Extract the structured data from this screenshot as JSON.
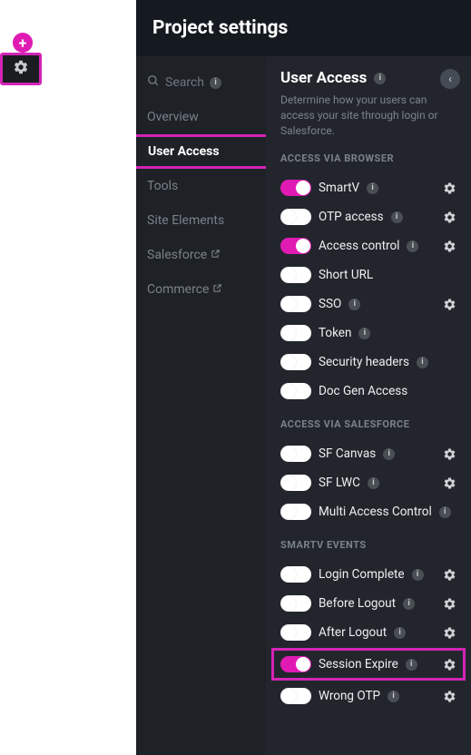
{
  "colors": {
    "accent": "#e01bb4",
    "highlight": "#d324b7"
  },
  "plus_label": "+",
  "gear_btn": "gear",
  "panel": {
    "title": "Project settings",
    "search_placeholder": "Search",
    "nav": [
      {
        "label": "Overview",
        "active": false,
        "external": false
      },
      {
        "label": "User Access",
        "active": true,
        "external": false
      },
      {
        "label": "Tools",
        "active": false,
        "external": false
      },
      {
        "label": "Site Elements",
        "active": false,
        "external": false
      },
      {
        "label": "Salesforce",
        "active": false,
        "external": true
      },
      {
        "label": "Commerce",
        "active": false,
        "external": true
      }
    ]
  },
  "content": {
    "title": "User Access",
    "description": "Determine how your users can access your site through login or Salesforce.",
    "groups": [
      {
        "label": "ACCESS VIA BROWSER",
        "items": [
          {
            "label": "SmartV",
            "on": true,
            "info": true,
            "gear": true
          },
          {
            "label": "OTP access",
            "on": false,
            "info": true,
            "gear": true
          },
          {
            "label": "Access control",
            "on": true,
            "info": true,
            "gear": true
          },
          {
            "label": "Short URL",
            "on": false,
            "info": false,
            "gear": false
          },
          {
            "label": "SSO",
            "on": false,
            "info": true,
            "gear": true
          },
          {
            "label": "Token",
            "on": false,
            "info": true,
            "gear": false
          },
          {
            "label": "Security headers",
            "on": false,
            "info": true,
            "gear": false
          },
          {
            "label": "Doc Gen Access",
            "on": false,
            "info": false,
            "gear": false
          }
        ]
      },
      {
        "label": "ACCESS VIA SALESFORCE",
        "items": [
          {
            "label": "SF Canvas",
            "on": false,
            "info": true,
            "gear": true
          },
          {
            "label": "SF LWC",
            "on": false,
            "info": true,
            "gear": true
          },
          {
            "label": "Multi Access Control",
            "on": false,
            "info": true,
            "gear": false
          }
        ]
      },
      {
        "label": "SMARTV EVENTS",
        "items": [
          {
            "label": "Login Complete",
            "on": false,
            "info": true,
            "gear": true
          },
          {
            "label": "Before Logout",
            "on": false,
            "info": true,
            "gear": true
          },
          {
            "label": "After Logout",
            "on": false,
            "info": true,
            "gear": true
          },
          {
            "label": "Session Expire",
            "on": true,
            "info": true,
            "gear": true,
            "highlighted": true
          },
          {
            "label": "Wrong OTP",
            "on": false,
            "info": true,
            "gear": true
          }
        ]
      }
    ]
  }
}
